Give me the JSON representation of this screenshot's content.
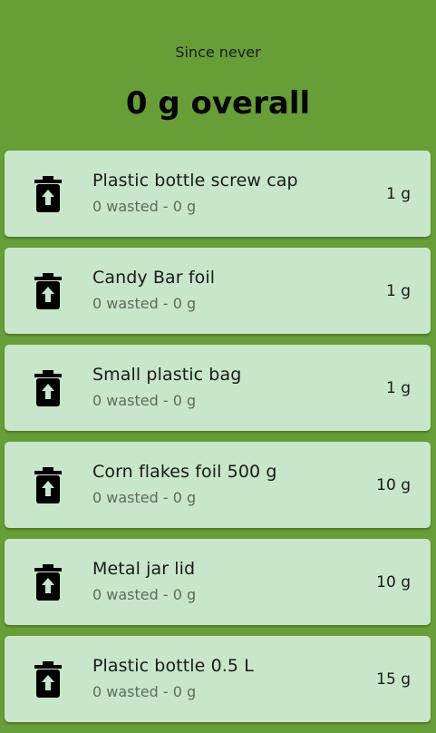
{
  "header": {
    "since": "Since never",
    "overall": "0 g overall"
  },
  "items": [
    {
      "name": "Plastic bottle screw cap",
      "subtitle": "0 wasted - 0 g",
      "weight": "1 g",
      "icon": "trash-upload-icon"
    },
    {
      "name": "Candy Bar foil",
      "subtitle": "0 wasted - 0 g",
      "weight": "1 g",
      "icon": "trash-upload-icon"
    },
    {
      "name": "Small plastic bag",
      "subtitle": "0 wasted - 0 g",
      "weight": "1 g",
      "icon": "trash-upload-icon"
    },
    {
      "name": "Corn flakes foil 500 g",
      "subtitle": "0 wasted - 0 g",
      "weight": "10 g",
      "icon": "trash-upload-icon"
    },
    {
      "name": "Metal jar lid",
      "subtitle": "0 wasted - 0 g",
      "weight": "10 g",
      "icon": "trash-upload-icon"
    },
    {
      "name": "Plastic bottle 0.5 L",
      "subtitle": "0 wasted - 0 g",
      "weight": "15 g",
      "icon": "trash-upload-icon"
    }
  ],
  "colors": {
    "background": "#679e37",
    "card": "#c8e6c9",
    "icon": "#000000",
    "icon_arrow": "#c8e6c9"
  }
}
